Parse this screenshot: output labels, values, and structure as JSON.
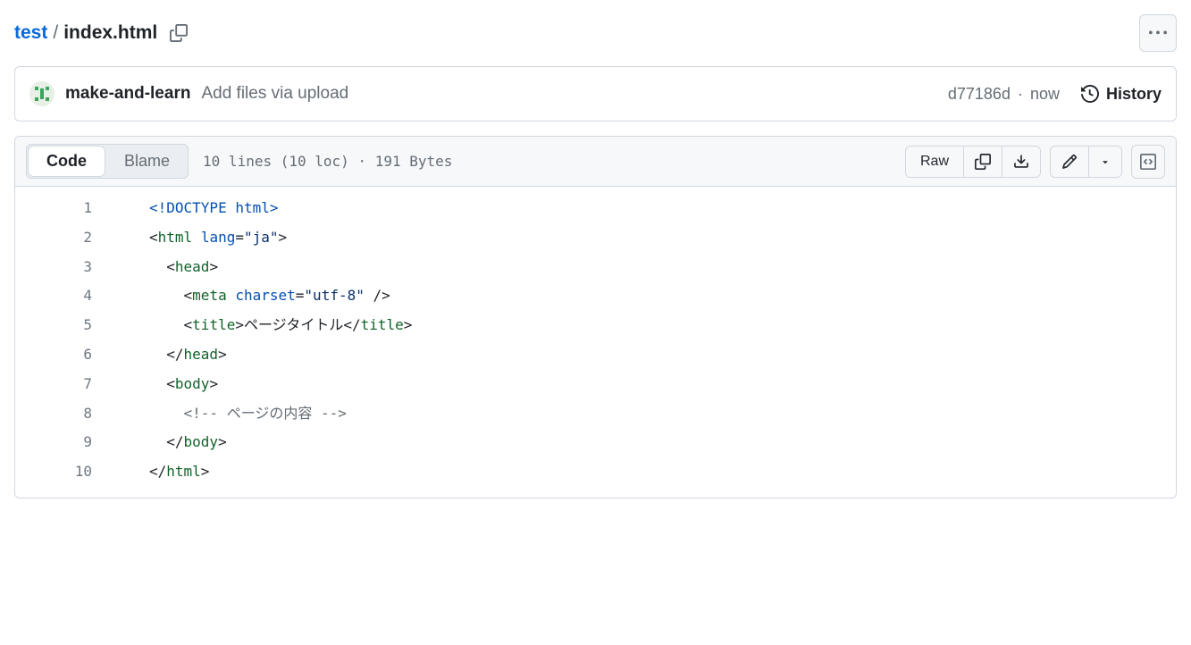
{
  "breadcrumb": {
    "dir": "test",
    "sep": "/",
    "file": "index.html"
  },
  "commit": {
    "author": "make-and-learn",
    "message": "Add files via upload",
    "hash": "d77186d",
    "time": "now",
    "history_label": "History"
  },
  "file_header": {
    "tabs": {
      "code": "Code",
      "blame": "Blame"
    },
    "info": "10 lines (10 loc) · 191 Bytes",
    "raw_label": "Raw"
  },
  "code": {
    "lines": [
      {
        "n": "1",
        "indent": 0,
        "type": "doctype",
        "text": "<!DOCTYPE html>"
      },
      {
        "n": "2",
        "indent": 0,
        "type": "open",
        "tag": "html",
        "attrs": [
          {
            "name": "lang",
            "value": "\"ja\""
          }
        ]
      },
      {
        "n": "3",
        "indent": 1,
        "type": "open",
        "tag": "head"
      },
      {
        "n": "4",
        "indent": 2,
        "type": "selfclose",
        "tag": "meta",
        "attrs": [
          {
            "name": "charset",
            "value": "\"utf-8\""
          }
        ]
      },
      {
        "n": "5",
        "indent": 2,
        "type": "pair",
        "tag": "title",
        "inner": "ページタイトル"
      },
      {
        "n": "6",
        "indent": 1,
        "type": "close",
        "tag": "head"
      },
      {
        "n": "7",
        "indent": 1,
        "type": "open",
        "tag": "body"
      },
      {
        "n": "8",
        "indent": 2,
        "type": "comment",
        "text": "<!-- ページの内容 -->"
      },
      {
        "n": "9",
        "indent": 1,
        "type": "close",
        "tag": "body"
      },
      {
        "n": "10",
        "indent": 0,
        "type": "close",
        "tag": "html"
      }
    ]
  }
}
